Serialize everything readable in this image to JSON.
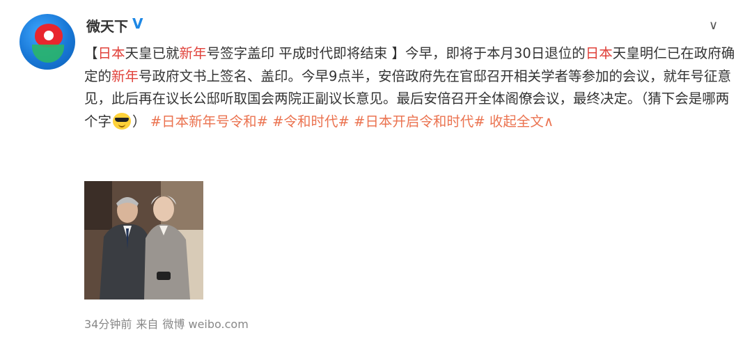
{
  "user": {
    "name": "微天下",
    "verified_badge": "V"
  },
  "menu": {
    "chevron": "∨"
  },
  "post": {
    "line_segments": [
      {
        "t": "【",
        "c": "n"
      },
      {
        "t": "日本",
        "c": "h"
      },
      {
        "t": "天皇已就",
        "c": "n"
      },
      {
        "t": "新年",
        "c": "h"
      },
      {
        "t": "号签字盖印 平成时代即将结束 】今早，即将于本月30日退位的",
        "c": "n"
      },
      {
        "t": "日本",
        "c": "h"
      },
      {
        "t": "天皇明仁已在政府确定的",
        "c": "n"
      },
      {
        "t": "新年",
        "c": "h"
      },
      {
        "t": "号政府文书上签名、盖印。今早9点半，安倍政府先在官邸召开相关学者等参加的会议，就年号征意见，此后再在议长公邸听取国会两院正副议长意见。最后安倍召开全体阁僚会议，最终决定。（猜下会是哪两个字",
        "c": "n"
      }
    ],
    "after_emoji": "）",
    "hashtags": [
      "#日本新年号令和#",
      "#令和时代#",
      "#日本开启令和时代#"
    ],
    "collapse_label": "收起全文",
    "collapse_icon": "∧"
  },
  "footer": {
    "time": "34分钟前",
    "from_label": "来自",
    "source": "微博 weibo.com"
  },
  "colors": {
    "highlight": "#e0413a",
    "hashtag": "#eb7350",
    "verified": "#1e88e5"
  }
}
